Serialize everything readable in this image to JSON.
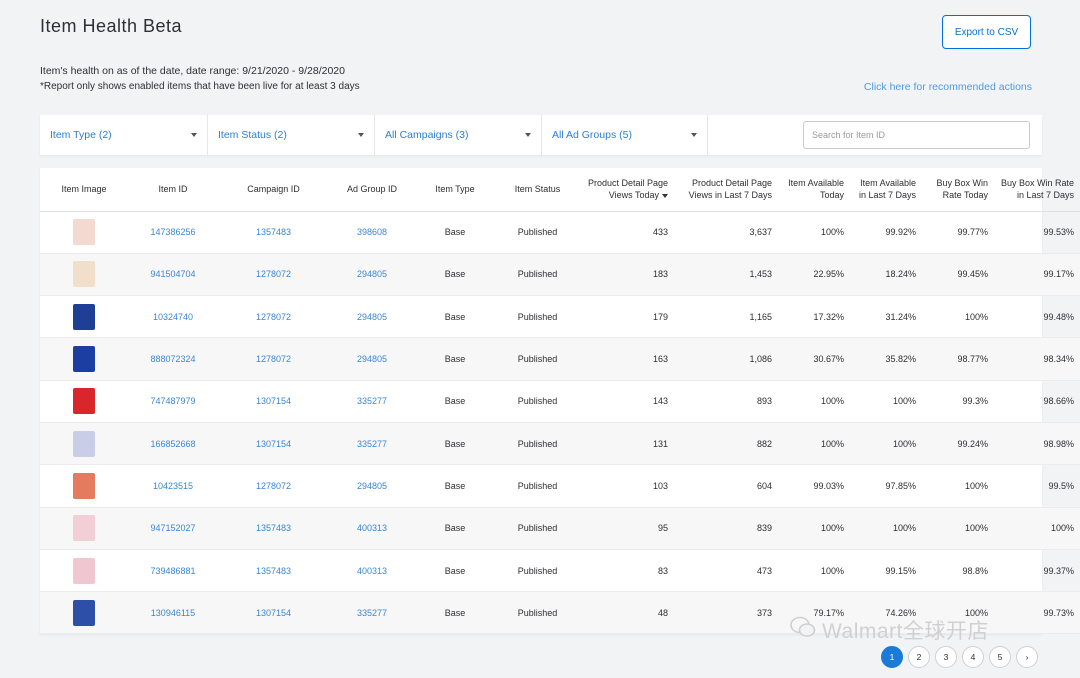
{
  "header": {
    "title": "Item Health Beta",
    "export_label": "Export to CSV",
    "health_line": "Item's health on as of the date, date range: 9/21/2020 - 9/28/2020",
    "report_note": "*Report only shows enabled items that have been live for at least 3 days",
    "recommend_link": "Click here for recommended actions"
  },
  "filters": {
    "item_type": "Item Type (2)",
    "item_status": "Item Status (2)",
    "campaigns": "All Campaigns (3)",
    "ad_groups": "All Ad Groups (5)",
    "search_placeholder": "Search for Item ID"
  },
  "table": {
    "headers": {
      "image": "Item Image",
      "item_id": "Item ID",
      "campaign_id": "Campaign ID",
      "ad_group_id": "Ad Group ID",
      "item_type": "Item Type",
      "item_status": "Item Status",
      "pdp_today_l1": "Product Detail Page",
      "pdp_today_l2": "Views Today",
      "pdp_7d_l1": "Product Detail Page",
      "pdp_7d_l2": "Views in Last 7 Days",
      "avail_today_l1": "Item Available",
      "avail_today_l2": "Today",
      "avail_7d_l1": "Item Available",
      "avail_7d_l2": "in Last 7 Days",
      "bb_today_l1": "Buy Box Win",
      "bb_today_l2": "Rate Today",
      "bb_7d_l1": "Buy Box Win Rate",
      "bb_7d_l2": "in Last 7 Days"
    },
    "rows": [
      {
        "thumb": "#f3d9cf",
        "item_id": "147386256",
        "campaign_id": "1357483",
        "ad_group_id": "398608",
        "type": "Base",
        "status": "Published",
        "pdp_today": "433",
        "pdp_7d": "3,637",
        "avail_today": "100%",
        "avail_7d": "99.92%",
        "bb_today": "99.77%",
        "bb_7d": "99.53%"
      },
      {
        "thumb": "#f1dfcc",
        "item_id": "941504704",
        "campaign_id": "1278072",
        "ad_group_id": "294805",
        "type": "Base",
        "status": "Published",
        "pdp_today": "183",
        "pdp_7d": "1,453",
        "avail_today": "22.95%",
        "avail_7d": "18.24%",
        "bb_today": "99.45%",
        "bb_7d": "99.17%"
      },
      {
        "thumb": "#1f3f96",
        "item_id": "10324740",
        "campaign_id": "1278072",
        "ad_group_id": "294805",
        "type": "Base",
        "status": "Published",
        "pdp_today": "179",
        "pdp_7d": "1,165",
        "avail_today": "17.32%",
        "avail_7d": "31.24%",
        "bb_today": "100%",
        "bb_7d": "99.48%"
      },
      {
        "thumb": "#1c3ea3",
        "item_id": "888072324",
        "campaign_id": "1278072",
        "ad_group_id": "294805",
        "type": "Base",
        "status": "Published",
        "pdp_today": "163",
        "pdp_7d": "1,086",
        "avail_today": "30.67%",
        "avail_7d": "35.82%",
        "bb_today": "98.77%",
        "bb_7d": "98.34%"
      },
      {
        "thumb": "#d8262c",
        "item_id": "747487979",
        "campaign_id": "1307154",
        "ad_group_id": "335277",
        "type": "Base",
        "status": "Published",
        "pdp_today": "143",
        "pdp_7d": "893",
        "avail_today": "100%",
        "avail_7d": "100%",
        "bb_today": "99.3%",
        "bb_7d": "98.66%"
      },
      {
        "thumb": "#c9cde8",
        "item_id": "166852668",
        "campaign_id": "1307154",
        "ad_group_id": "335277",
        "type": "Base",
        "status": "Published",
        "pdp_today": "131",
        "pdp_7d": "882",
        "avail_today": "100%",
        "avail_7d": "100%",
        "bb_today": "99.24%",
        "bb_7d": "98.98%"
      },
      {
        "thumb": "#e47a5e",
        "item_id": "10423515",
        "campaign_id": "1278072",
        "ad_group_id": "294805",
        "type": "Base",
        "status": "Published",
        "pdp_today": "103",
        "pdp_7d": "604",
        "avail_today": "99.03%",
        "avail_7d": "97.85%",
        "bb_today": "100%",
        "bb_7d": "99.5%"
      },
      {
        "thumb": "#f2cfd6",
        "item_id": "947152027",
        "campaign_id": "1357483",
        "ad_group_id": "400313",
        "type": "Base",
        "status": "Published",
        "pdp_today": "95",
        "pdp_7d": "839",
        "avail_today": "100%",
        "avail_7d": "100%",
        "bb_today": "100%",
        "bb_7d": "100%"
      },
      {
        "thumb": "#f0c7d1",
        "item_id": "739486881",
        "campaign_id": "1357483",
        "ad_group_id": "400313",
        "type": "Base",
        "status": "Published",
        "pdp_today": "83",
        "pdp_7d": "473",
        "avail_today": "100%",
        "avail_7d": "99.15%",
        "bb_today": "98.8%",
        "bb_7d": "99.37%"
      },
      {
        "thumb": "#2e4fa8",
        "item_id": "130946115",
        "campaign_id": "1307154",
        "ad_group_id": "335277",
        "type": "Base",
        "status": "Published",
        "pdp_today": "48",
        "pdp_7d": "373",
        "avail_today": "79.17%",
        "avail_7d": "74.26%",
        "bb_today": "100%",
        "bb_7d": "99.73%"
      }
    ]
  },
  "pagination": {
    "pages": [
      "1",
      "2",
      "3",
      "4",
      "5"
    ],
    "next": "›",
    "active": "1"
  },
  "watermark": "Walmart全球开店"
}
